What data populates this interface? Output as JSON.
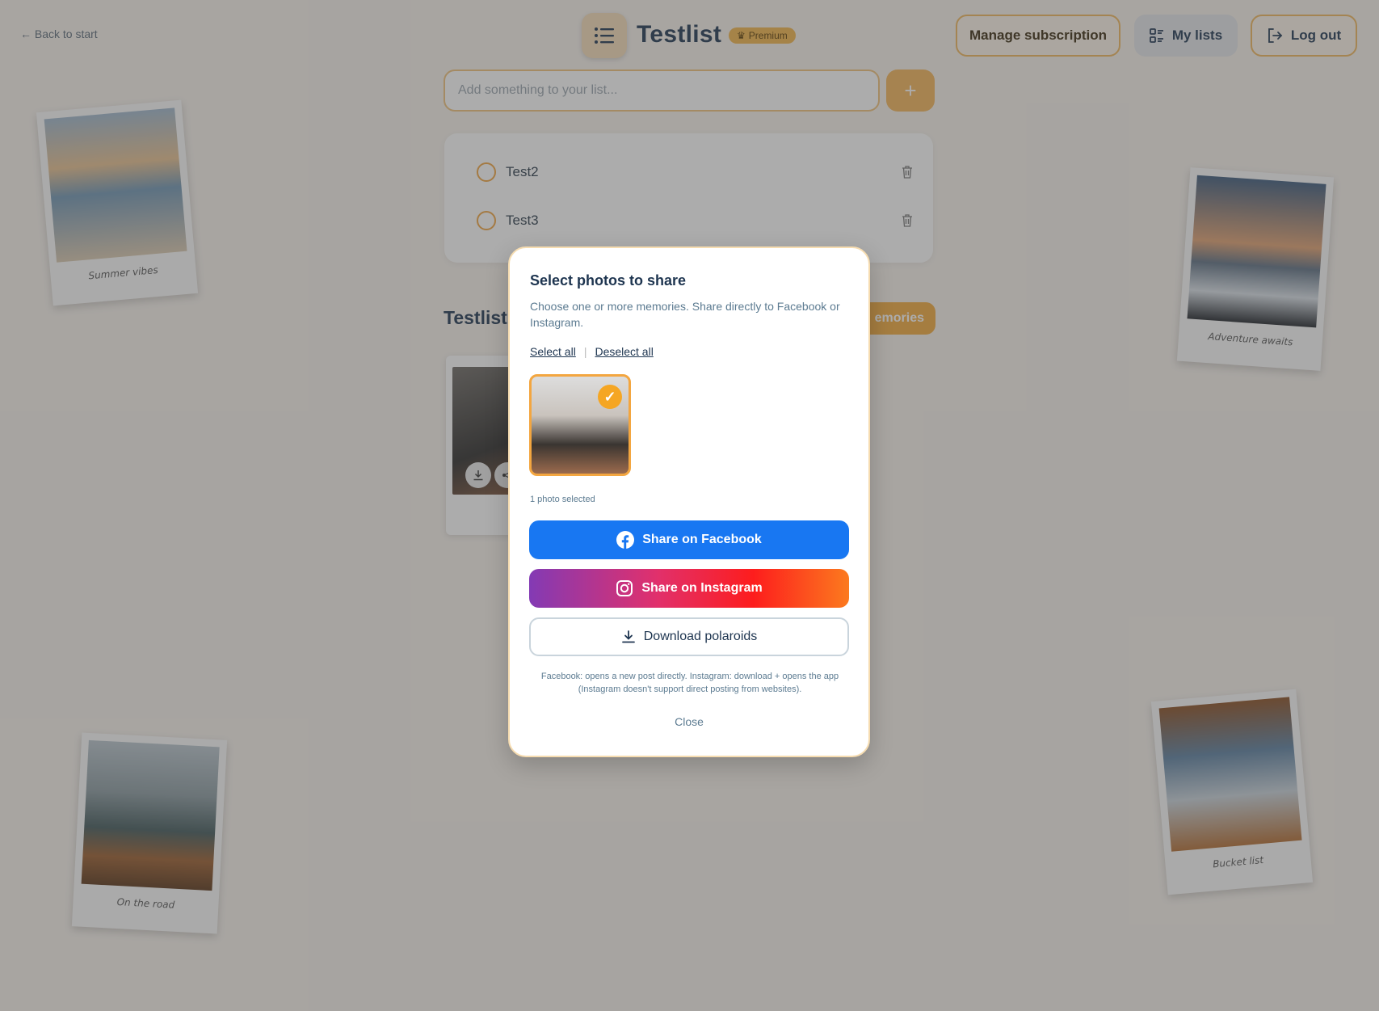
{
  "header": {
    "back_label": "← Back to start",
    "title": "Testlist",
    "badge": "Premium",
    "manage_label": "Manage subscription",
    "my_lists_label": "My lists",
    "logout_label": "Log out"
  },
  "add": {
    "placeholder": "Add something to your list...",
    "button": "+"
  },
  "items": [
    {
      "label": "Test2"
    },
    {
      "label": "Test3"
    }
  ],
  "memories": {
    "title": "Testlist",
    "button": "emories"
  },
  "polaroids": [
    {
      "caption": "Summer vibes"
    },
    {
      "caption": "Adventure awaits"
    },
    {
      "caption": "On the road"
    },
    {
      "caption": "Bucket list"
    }
  ],
  "modal": {
    "title": "Select photos to share",
    "description": "Choose one or more memories. Share directly to Facebook or Instagram.",
    "select_all": "Select all",
    "deselect_all": "Deselect all",
    "selected_count": "1 photo selected",
    "facebook": "Share on Facebook",
    "instagram": "Share on Instagram",
    "download": "Download polaroids",
    "note": "Facebook: opens a new post directly. Instagram: download + opens the app (Instagram doesn't support direct posting from websites).",
    "close": "Close"
  },
  "colors": {
    "accent": "#f5a623",
    "facebook": "#1877f2",
    "navy": "#1e3550"
  }
}
